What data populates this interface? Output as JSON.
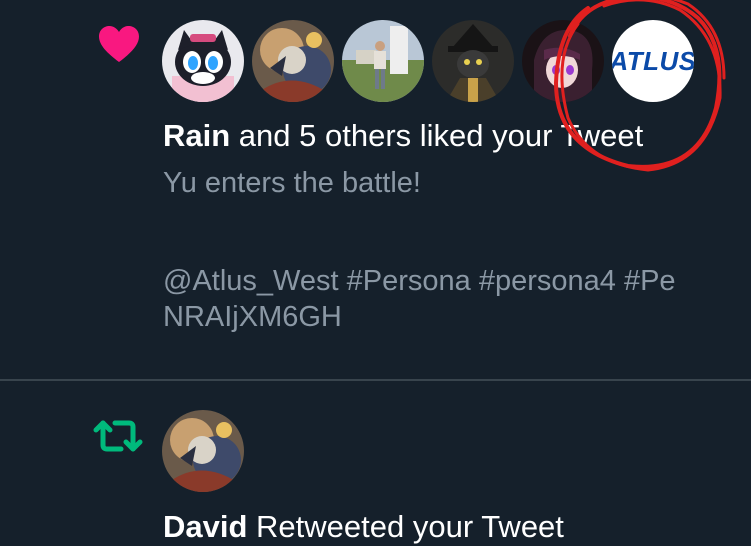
{
  "colors": {
    "background": "#15202b",
    "divider": "#38444d",
    "like_heart": "#f91880",
    "retweet": "#00ba7c",
    "text_primary": "#ffffff",
    "text_secondary": "#8b98a5",
    "annotation_circle": "#e0201f"
  },
  "like_notification": {
    "icon": "heart-icon",
    "avatars": [
      {
        "name": "Rain",
        "style": "cat-mascot"
      },
      {
        "name": "",
        "style": "anime-art"
      },
      {
        "name": "",
        "style": "photo-person"
      },
      {
        "name": "",
        "style": "dark-character"
      },
      {
        "name": "",
        "style": "purple-hair"
      },
      {
        "name": "Atlus",
        "style": "logo",
        "logo_text": "ATLUS"
      }
    ],
    "actor": "Rain",
    "action": " and 5 others liked your Tweet",
    "tweet_lines": [
      "Yu enters the battle!",
      "@Atlus_West #Persona #persona4 #Pe",
      "NRAIjXM6GH"
    ]
  },
  "retweet_notification": {
    "icon": "retweet-icon",
    "avatar": {
      "name": "David",
      "style": "anime-art"
    },
    "actor": "David",
    "action": " Retweeted your Tweet"
  }
}
